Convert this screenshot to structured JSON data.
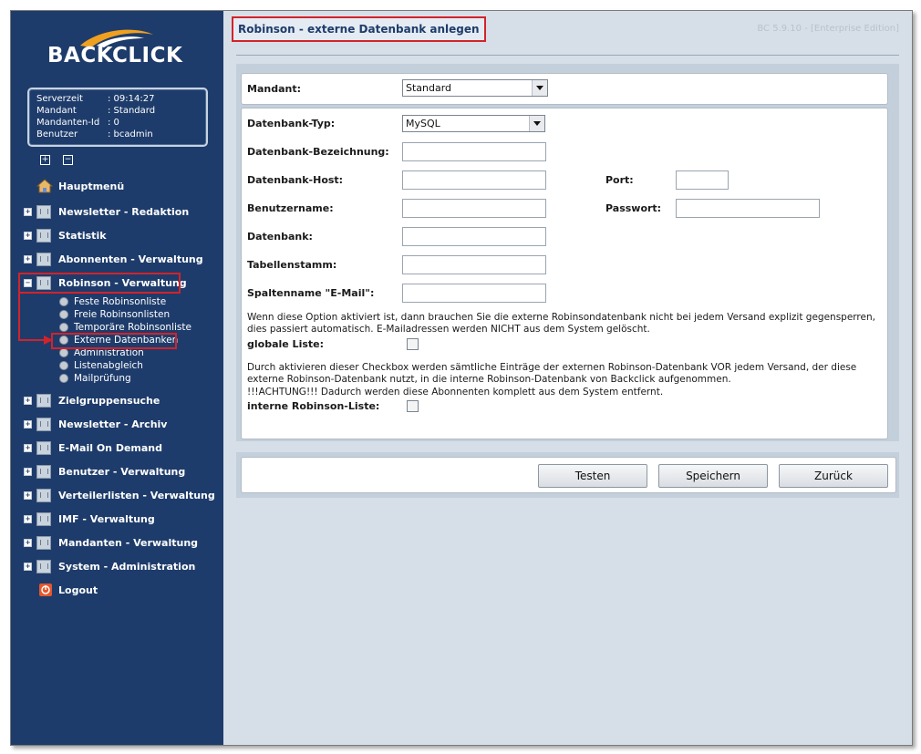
{
  "sidebar": {
    "logo": "BACKCLICK",
    "info": [
      {
        "label": "Serverzeit",
        "value": ": 09:14:27"
      },
      {
        "label": "Mandant",
        "value": ": Standard"
      },
      {
        "label": "Mandanten-Id",
        "value": ": 0"
      },
      {
        "label": "Benutzer",
        "value": ": bcadmin"
      }
    ],
    "expand_all": "+",
    "collapse_all": "−",
    "menu": [
      {
        "label": "Hauptmenü"
      },
      {
        "label": "Newsletter - Redaktion"
      },
      {
        "label": "Statistik"
      },
      {
        "label": "Abonnenten - Verwaltung"
      },
      {
        "label": "Robinson - Verwaltung"
      },
      {
        "label": "Zielgruppensuche"
      },
      {
        "label": "Newsletter - Archiv"
      },
      {
        "label": "E-Mail On Demand"
      },
      {
        "label": "Benutzer - Verwaltung"
      },
      {
        "label": "Verteilerlisten - Verwaltung"
      },
      {
        "label": "IMF - Verwaltung"
      },
      {
        "label": "Mandanten - Verwaltung"
      },
      {
        "label": "System - Administration"
      },
      {
        "label": "Logout"
      }
    ],
    "robinson_sub": [
      "Feste Robinsonliste",
      "Freie Robinsonlisten",
      "Temporäre Robinsonliste",
      "Externe Datenbanken",
      "Administration",
      "Listenabgleich",
      "Mailprüfung"
    ]
  },
  "main": {
    "title": "Robinson - externe Datenbank anlegen",
    "version": "BC 5.9.10 - [Enterprise Edition]",
    "mandant": {
      "label": "Mandant:",
      "value": "Standard"
    },
    "form": {
      "db_type": {
        "label": "Datenbank-Typ:",
        "value": "MySQL"
      },
      "db_name": {
        "label": "Datenbank-Bezeichnung:",
        "value": ""
      },
      "db_host": {
        "label": "Datenbank-Host:",
        "value": ""
      },
      "port": {
        "label": "Port:",
        "value": ""
      },
      "username": {
        "label": "Benutzername:",
        "value": ""
      },
      "password": {
        "label": "Passwort:",
        "value": ""
      },
      "database": {
        "label": "Datenbank:",
        "value": ""
      },
      "table_stem": {
        "label": "Tabellenstamm:",
        "value": ""
      },
      "email_col": {
        "label": "Spaltenname \"E-Mail\":",
        "value": ""
      },
      "global_note": "Wenn diese Option aktiviert ist, dann brauchen Sie die externe Robinsondatenbank nicht bei jedem Versand explizit gegensperren, dies passiert automatisch. E-Mailadressen werden NICHT aus dem System gelöscht.",
      "global_label": "globale Liste:",
      "internal_note_1": "Durch aktivieren dieser Checkbox werden sämtliche Einträge der externen Robinson-Datenbank VOR jedem Versand, der diese externe Robinson-Datenbank nutzt, in die interne Robinson-Datenbank von Backclick aufgenommen.",
      "internal_note_2": "!!!ACHTUNG!!! Dadurch werden diese Abonnenten komplett aus dem System entfernt.",
      "internal_label": "interne Robinson-Liste:"
    },
    "buttons": {
      "test": "Testen",
      "save": "Speichern",
      "back": "Zurück"
    }
  }
}
